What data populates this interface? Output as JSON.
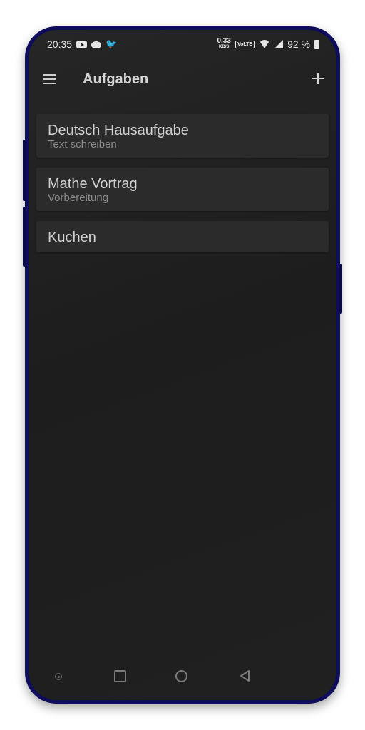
{
  "status_bar": {
    "time": "20:35",
    "notification_icons": [
      "youtube-icon",
      "reddit-icon",
      "twitter-icon"
    ],
    "network_speed": "0.33",
    "network_speed_unit": "KB/S",
    "volte": "VoLTE",
    "battery": "92 %"
  },
  "app_bar": {
    "title": "Aufgaben",
    "menu_icon": "menu-icon",
    "add_icon": "add-icon"
  },
  "tasks": [
    {
      "title": "Deutsch Hausaufgabe",
      "subtitle": "Text schreiben"
    },
    {
      "title": "Mathe Vortrag",
      "subtitle": "Vorbereitung"
    },
    {
      "title": "Kuchen",
      "subtitle": ""
    }
  ],
  "nav_bar": {
    "icons": [
      "assistant-dot-icon",
      "recents-icon",
      "home-icon",
      "back-icon"
    ]
  },
  "colors": {
    "frame": "#0d0d5c",
    "screen_background": "#1f1f1f",
    "card_background": "#2b2b2b",
    "title_text": "#d0d0d0",
    "subtitle_text": "#8a8a8a"
  }
}
